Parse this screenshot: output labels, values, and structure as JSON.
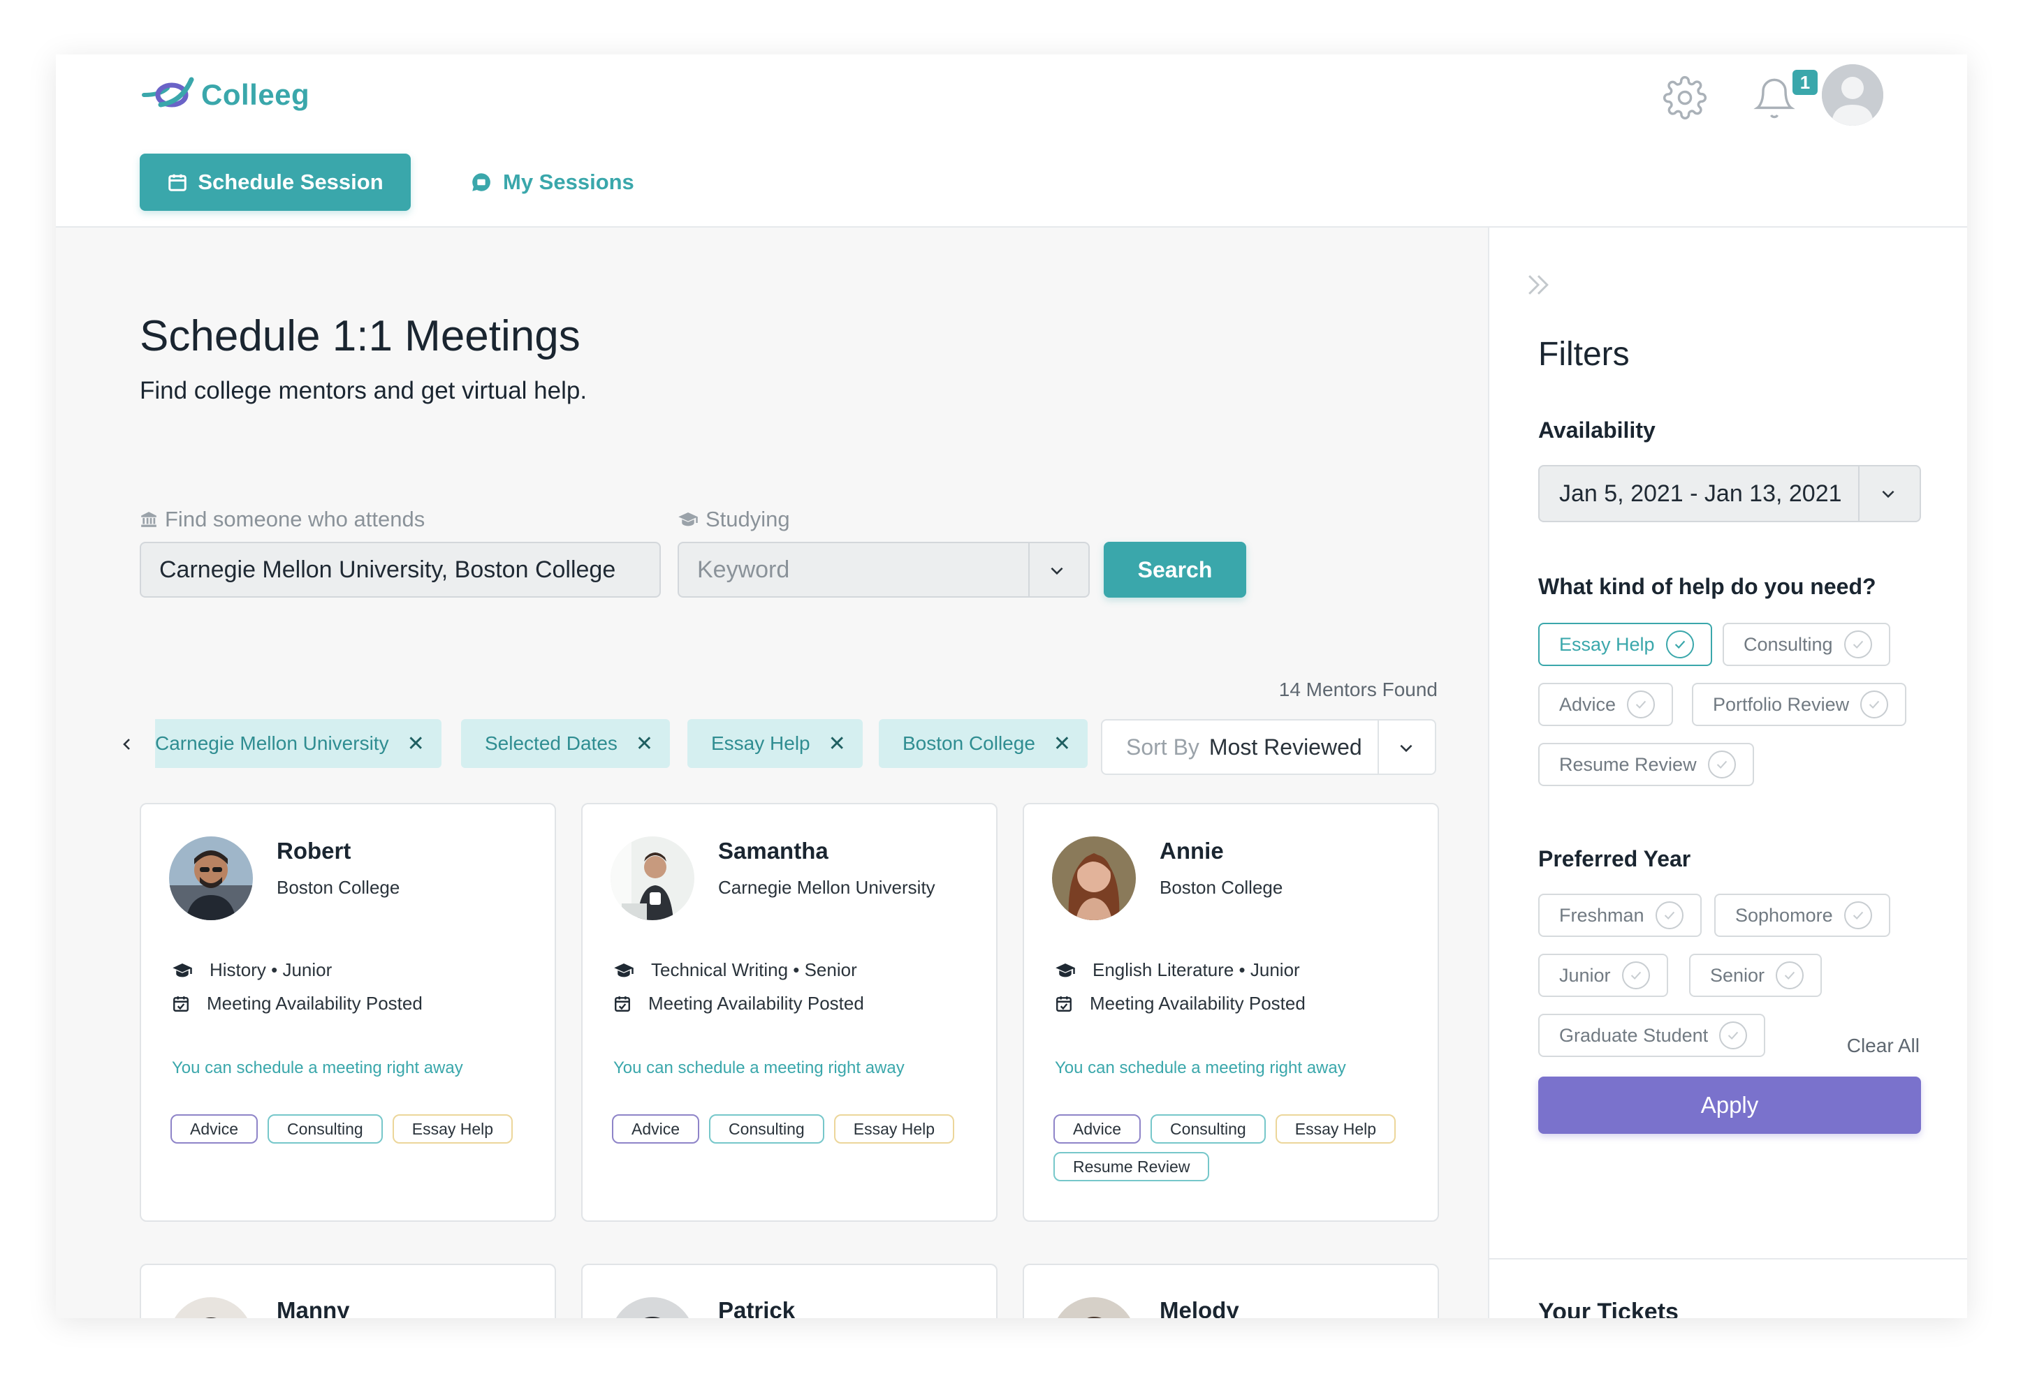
{
  "app": {
    "name": "Colleeg",
    "notification_count": "1"
  },
  "nav": {
    "schedule_label": "Schedule Session",
    "sessions_label": "My Sessions"
  },
  "page": {
    "title": "Schedule 1:1 Meetings",
    "subtitle": "Find college mentors and get virtual help."
  },
  "search": {
    "school_label": "Find someone who attends",
    "school_value": "Carnegie Mellon University, Boston College",
    "study_label": "Studying",
    "study_placeholder": "Keyword",
    "button": "Search"
  },
  "results": {
    "found": "14 Mentors Found"
  },
  "chips": [
    {
      "label": "Carnegie Mellon University"
    },
    {
      "label": "Selected Dates"
    },
    {
      "label": "Essay Help"
    },
    {
      "label": "Boston College"
    }
  ],
  "chip_close": "✕",
  "sort": {
    "prefix": "Sort By",
    "value": "Most Reviewed"
  },
  "mentors": [
    {
      "name": "Robert",
      "school": "Boston College",
      "study": "History • Junior",
      "availability": "Meeting Availability Posted",
      "note": "You can schedule a meeting right away",
      "tags": [
        "Advice",
        "Consulting",
        "Essay Help"
      ]
    },
    {
      "name": "Samantha",
      "school": "Carnegie Mellon University",
      "study": "Technical Writing • Senior",
      "availability": "Meeting Availability Posted",
      "note": "You can schedule a meeting right away",
      "tags": [
        "Advice",
        "Consulting",
        "Essay Help"
      ]
    },
    {
      "name": "Annie",
      "school": "Boston College",
      "study": "English Literature • Junior",
      "availability": "Meeting Availability Posted",
      "note": "You can schedule a meeting right away",
      "tags": [
        "Advice",
        "Consulting",
        "Essay Help",
        "Resume Review"
      ]
    },
    {
      "name": "Manny"
    },
    {
      "name": "Patrick"
    },
    {
      "name": "Melody"
    }
  ],
  "filters": {
    "title": "Filters",
    "availability_label": "Availability",
    "date_range": "Jan 5, 2021 - Jan 13, 2021",
    "help_label": "What kind of help do you need?",
    "help_options": [
      "Essay Help",
      "Consulting",
      "Advice",
      "Portfolio Review",
      "Resume Review"
    ],
    "year_label": "Preferred Year",
    "year_options": [
      "Freshman",
      "Sophomore",
      "Junior",
      "Senior",
      "Graduate Student"
    ],
    "clear_all": "Clear All",
    "apply": "Apply",
    "tickets_label": "Your Tickets"
  },
  "colors": {
    "accent": "#3aa7ab",
    "apply": "#7a72cc",
    "chip_bg": "#d5eff0"
  }
}
